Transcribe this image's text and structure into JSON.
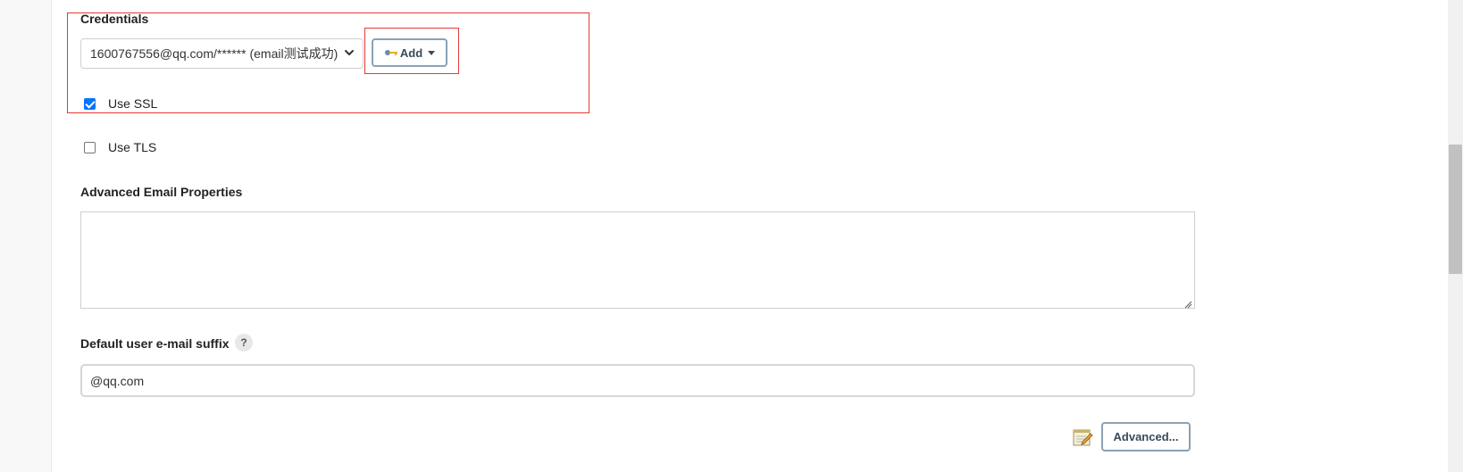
{
  "credentials": {
    "label": "Credentials",
    "selected_value": "1600767556@qq.com/****** (email测试成功)",
    "add_button_label": "Add"
  },
  "use_ssl": {
    "label": "Use SSL",
    "checked": true
  },
  "use_tls": {
    "label": "Use TLS",
    "checked": false
  },
  "advanced_email_properties": {
    "label": "Advanced Email Properties",
    "value": ""
  },
  "default_suffix": {
    "label": "Default user e-mail suffix",
    "help_symbol": "?",
    "value": "@qq.com"
  },
  "advanced_button_label": "Advanced...",
  "highlight_color": "#e53935",
  "icons": [
    "chevron-down-icon",
    "key-icon",
    "caret-down-icon",
    "help-icon",
    "resize-handle-icon",
    "notepad-icon"
  ]
}
